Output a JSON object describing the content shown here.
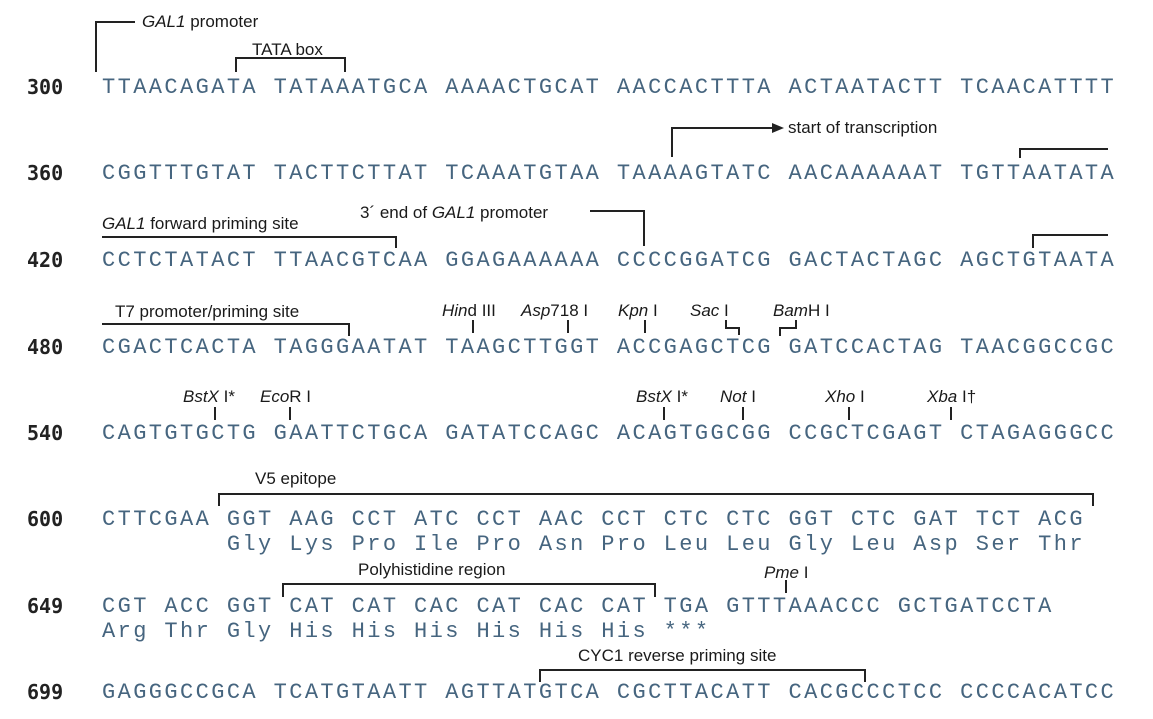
{
  "rows": [
    {
      "number": "300",
      "seq": "TTAACAGATA TATAAATGCA AAAACTGCAT AACCACTTTA ACTAATACTT TCAACATTTT"
    },
    {
      "number": "360",
      "seq": "CGGTTTGTAT TACTTCTTAT TCAAATGTAA TAAAAGTATC AACAAAAAAT TGTTAATATA"
    },
    {
      "number": "420",
      "seq": "CCTCTATACT TTAACGTCAA GGAGAAAAAA CCCCGGATCG GACTACTAGC AGCTGTAATA"
    },
    {
      "number": "480",
      "seq": "CGACTCACTA TAGGGAATAT TAAGCTTGGT ACCGAGCTCG GATCCACTAG TAACGGCCGC"
    },
    {
      "number": "540",
      "seq": "CAGTGTGCTG GAATTCTGCA GATATCCAGC ACAGTGGCGG CCGCTCGAGT CTAGAGGGCC"
    },
    {
      "number": "600",
      "seq": "CTTCGAA GGT AAG CCT ATC CCT AAC CCT CTC CTC GGT CTC GAT TCT ACG",
      "aa": "        Gly Lys Pro Ile Pro Asn Pro Leu Leu Gly Leu Asp Ser Thr"
    },
    {
      "number": "649",
      "seq": "CGT ACC GGT CAT CAT CAC CAT CAC CAT TGA GTTTAAACCC GCTGATCCTA",
      "aa": "Arg Thr Gly His His His His His His ***"
    },
    {
      "number": "699",
      "seq": "GAGGGCCGCA TCATGTAATT AGTTATGTCA CGCTTACATT CACGCCCTCC CCCCACATCC"
    }
  ],
  "annotations": {
    "gal1_promoter": {
      "italic": "GAL1",
      "text": " promoter"
    },
    "tata_box": {
      "text": "TATA box"
    },
    "start_transcription": {
      "text": "start of transcription"
    },
    "gal1_forward": {
      "italic": "GAL1",
      "text": " forward priming site"
    },
    "gal1_3prime_end": {
      "pre": "3´ end of ",
      "italic": "GAL1",
      "text": " promoter"
    },
    "t7": {
      "text": "T7 promoter/priming site"
    },
    "hind3": {
      "italic": "Hin",
      "text": "d III"
    },
    "asp718": {
      "italic": "Asp",
      "text": "718 I"
    },
    "kpn": {
      "italic": "Kpn",
      "text": " I"
    },
    "sac": {
      "italic": "Sac",
      "text": " I"
    },
    "bamh": {
      "italic": "Bam",
      "text": "H I"
    },
    "bstx_1": {
      "italic": "BstX",
      "text": " I*"
    },
    "ecor": {
      "italic": "Eco",
      "text": "R I"
    },
    "bstx_2": {
      "italic": "BstX",
      "text": " I*"
    },
    "not": {
      "italic": "Not",
      "text": " I"
    },
    "xho": {
      "italic": "Xho",
      "text": " I"
    },
    "xba": {
      "italic": "Xba",
      "text": " I†"
    },
    "v5": {
      "text": "V5 epitope"
    },
    "polyhis": {
      "text": "Polyhistidine region"
    },
    "pme": {
      "italic": "Pme",
      "text": " I"
    },
    "cyc1": {
      "text": "CYC1 reverse priming site"
    }
  },
  "colors": {
    "sequence": "#46657f",
    "annotation": "#222222"
  }
}
